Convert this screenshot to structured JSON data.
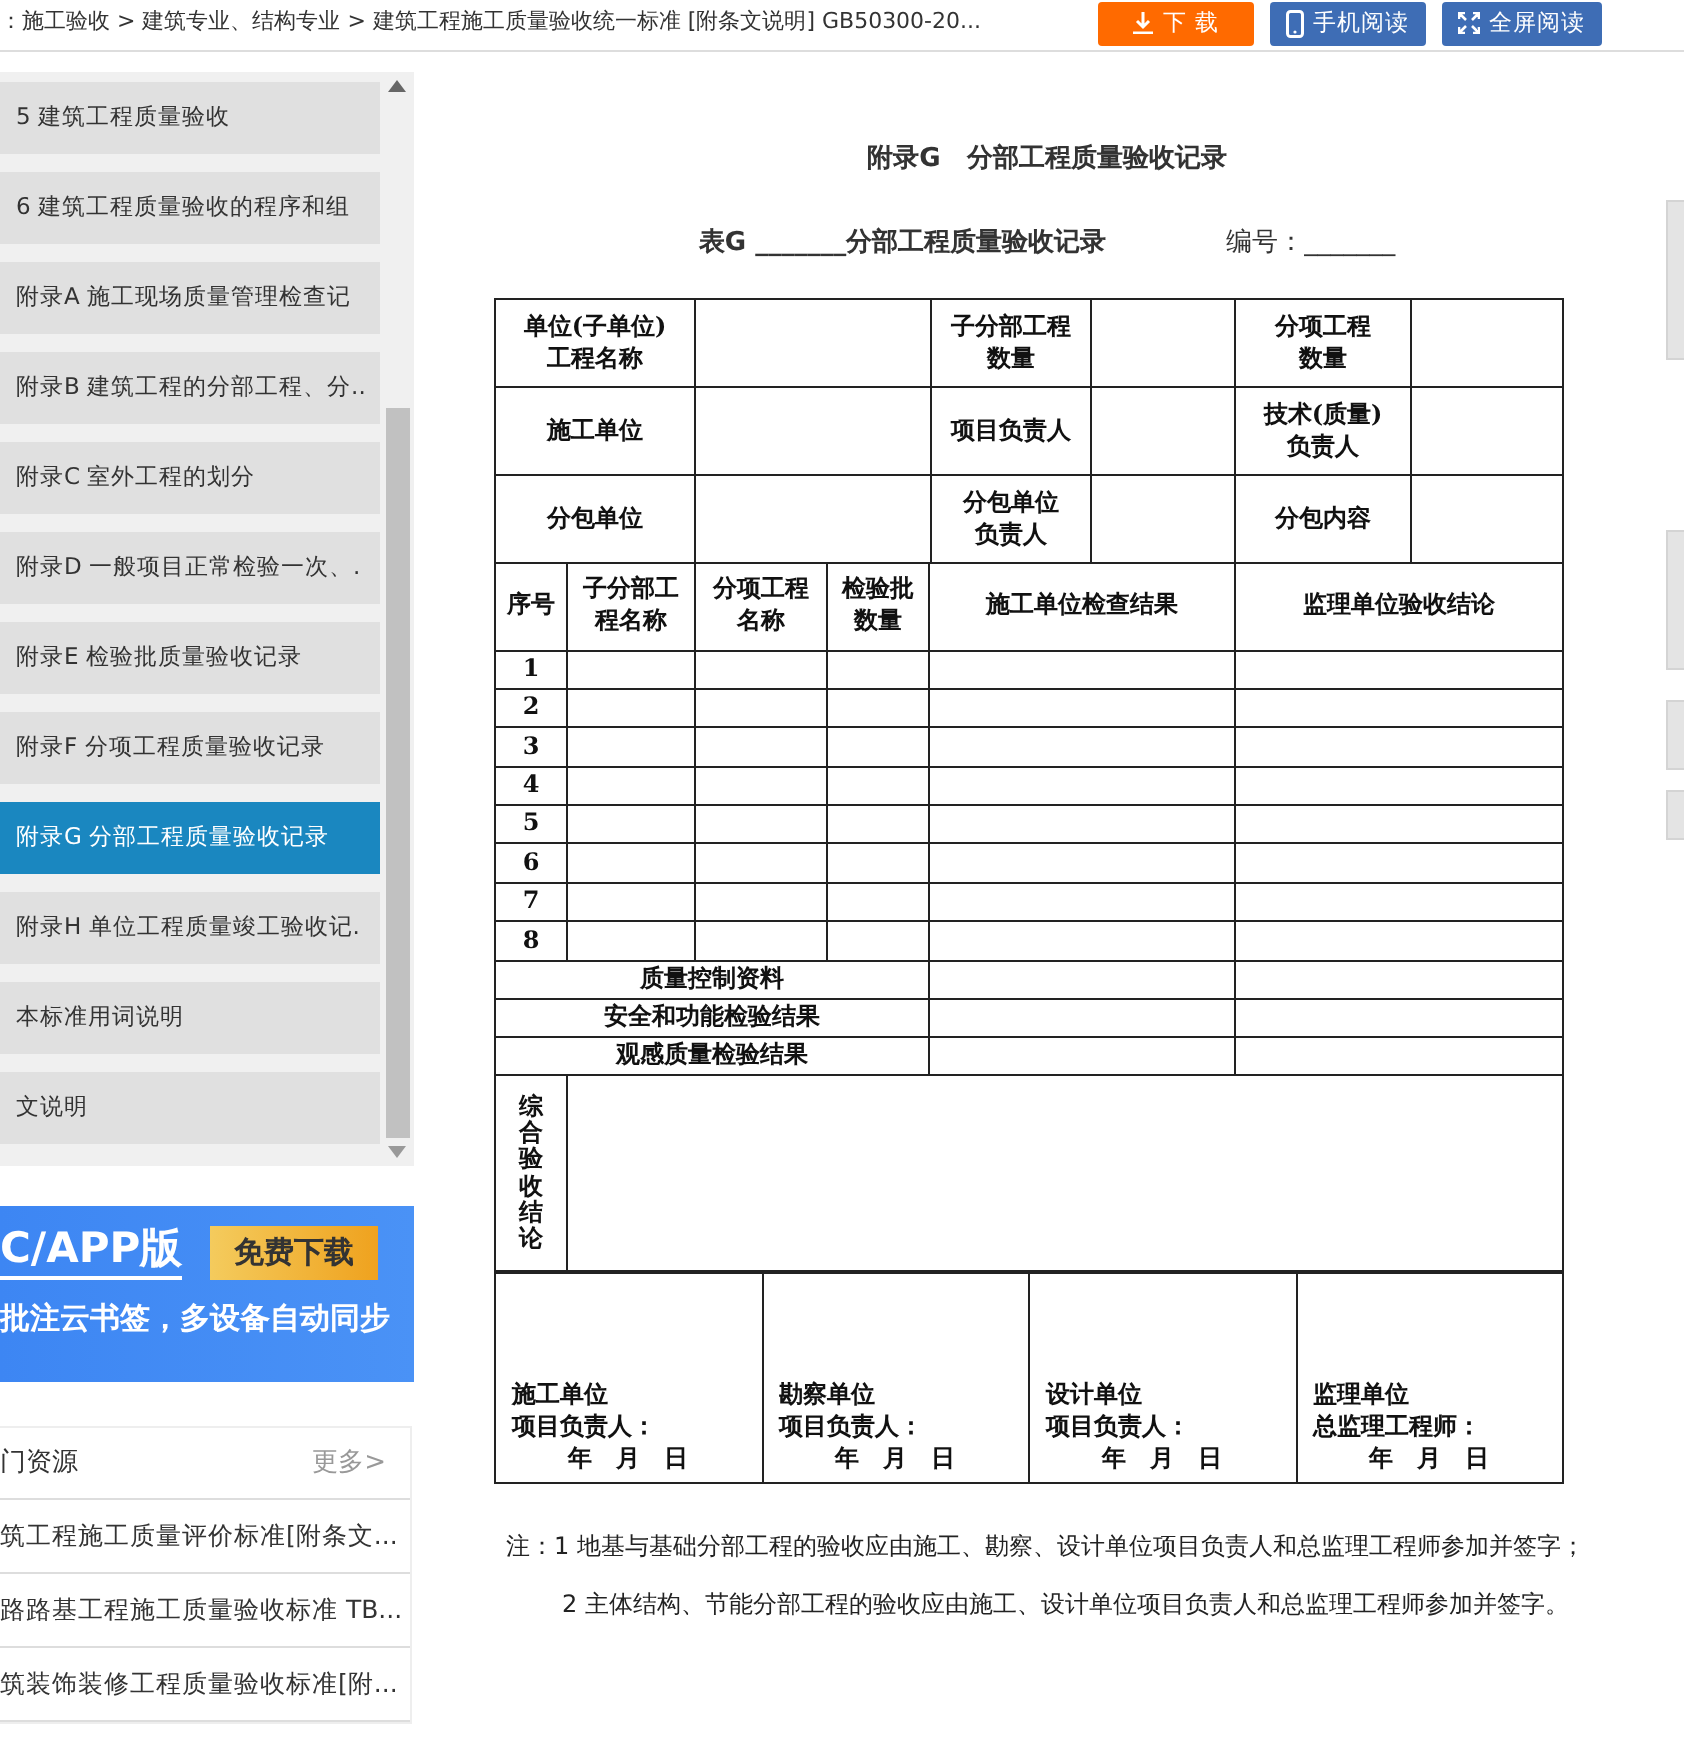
{
  "breadcrumb": "：施工验收 > 建筑专业、结构专业 > 建筑工程施工质量验收统一标准 [附条文说明] GB50300-20...",
  "toolbar": [
    {
      "kind": "download",
      "label": "下 载"
    },
    {
      "kind": "mobile",
      "label": "手机阅读"
    },
    {
      "kind": "fullscreen",
      "label": "全屏阅读"
    }
  ],
  "toc": [
    {
      "label": "5 建筑工程质量验收",
      "selected": false
    },
    {
      "label": "6 建筑工程质量验收的程序和组",
      "selected": false
    },
    {
      "label": "附录A 施工现场质量管理检查记",
      "selected": false
    },
    {
      "label": "附录B 建筑工程的分部工程、分..",
      "selected": false
    },
    {
      "label": "附录C 室外工程的划分",
      "selected": false
    },
    {
      "label": "附录D 一般项目正常检验一次、.",
      "selected": false
    },
    {
      "label": "附录E 检验批质量验收记录",
      "selected": false
    },
    {
      "label": "附录F 分项工程质量验收记录",
      "selected": false
    },
    {
      "label": "附录G 分部工程质量验收记录",
      "selected": true
    },
    {
      "label": "附录H 单位工程质量竣工验收记.",
      "selected": false
    },
    {
      "label": "本标准用词说明",
      "selected": false
    },
    {
      "label": "文说明",
      "selected": false
    }
  ],
  "promo": {
    "title": "C/APP版",
    "button": "免费下载",
    "subtitle": "批注云书签，多设备自动同步"
  },
  "hot": {
    "title": "门资源",
    "more": "更多>",
    "items": [
      "筑工程施工质量评价标准[附条文...",
      "路路基工程施工质量验收标准 TB...",
      "筑装饰装修工程质量验收标准[附..."
    ]
  },
  "doc": {
    "heading": "附录G　分部工程质量验收记录",
    "table_title": "表G _______分部工程质量验收记录",
    "number_label": "编号：_______",
    "info_rows": [
      [
        "单位(子单位)工程名称",
        "子分部工程数量",
        "分项工程数量"
      ],
      [
        "施工单位",
        "项目负责人",
        "技术(质量)负责人"
      ],
      [
        "分包单位",
        "分包单位负责人",
        "分包内容"
      ]
    ],
    "columns": [
      "序号",
      "子分部工程名称",
      "分项工程名称",
      "检验批数量",
      "施工单位检查结果",
      "监理单位验收结论"
    ],
    "row_numbers": [
      "1",
      "2",
      "3",
      "4",
      "5",
      "6",
      "7",
      "8"
    ],
    "summary_rows": [
      "质量控制资料",
      "安全和功能检验结果",
      "观感质量检验结果"
    ],
    "conclusion_label": "综合验收结论",
    "signatures": [
      {
        "unit": "施工单位",
        "person": "项目负责人：",
        "date": "年　月　日"
      },
      {
        "unit": "勘察单位",
        "person": "项目负责人：",
        "date": "年　月　日"
      },
      {
        "unit": "设计单位",
        "person": "项目负责人：",
        "date": "年　月　日"
      },
      {
        "unit": "监理单位",
        "person": "总监理工程师：",
        "date": "年　月　日"
      }
    ],
    "notes": [
      "注：1  地基与基础分部工程的验收应由施工、勘察、设计单位项目负责人和总监理工程师参加并签字；",
      "2  主体结构、节能分部工程的验收应由施工、设计单位项目负责人和总监理工程师参加并签字。"
    ]
  }
}
